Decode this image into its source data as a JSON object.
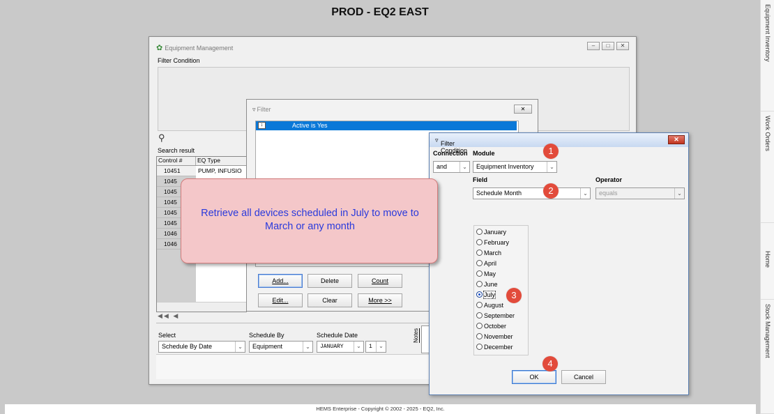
{
  "app": {
    "title": "PROD - EQ2 EAST",
    "footer": "HEMS Enterprise - Copyright © 2002 - 2025 - EQ2, Inc."
  },
  "right_rail": {
    "tabs": [
      "Equipment Inventory",
      "Work Orders",
      "Home",
      "Stock Management"
    ]
  },
  "equipment_window": {
    "title": "Equipment Management",
    "filter_condition_label": "Filter Condition",
    "search_result_label": "Search result",
    "columns": [
      "Control #",
      "EQ Type"
    ],
    "rows": [
      {
        "control": "10451",
        "type": "PUMP, INFUSIO"
      },
      {
        "control": "1045",
        "type": ""
      },
      {
        "control": "1045",
        "type": ""
      },
      {
        "control": "1045",
        "type": ""
      },
      {
        "control": "1045",
        "type": ""
      },
      {
        "control": "1045",
        "type": ""
      },
      {
        "control": "1046",
        "type": ""
      },
      {
        "control": "1046",
        "type": ""
      }
    ],
    "pager": "◀◀ ◀",
    "select_label": "Select",
    "select_value": "Schedule By Date",
    "schedule_by_label": "Schedule By",
    "schedule_by_value": "Equipment",
    "schedule_date_label": "Schedule Date",
    "schedule_month_value": "JANUARY",
    "schedule_day_value": "1",
    "notes_label": "Notes"
  },
  "filter_window": {
    "title": "Filter",
    "selected_condition": "Active is Yes",
    "buttons": {
      "add": "Add...",
      "delete": "Delete",
      "count": "Count",
      "edit": "Edit...",
      "clear": "Clear",
      "more": "More >>"
    }
  },
  "filter_condition_window": {
    "title": "Filter Condition",
    "connection_label": "Connection",
    "connection_value": "and",
    "module_label": "Module",
    "module_value": "Equipment Inventory",
    "field_label": "Field",
    "field_value": "Schedule Month",
    "operator_label": "Operator",
    "operator_value": "equals",
    "months": [
      "January",
      "February",
      "March",
      "April",
      "May",
      "June",
      "July",
      "August",
      "September",
      "October",
      "November",
      "December"
    ],
    "selected_month": "July",
    "ok": "OK",
    "cancel": "Cancel"
  },
  "callout": {
    "text": "Retrieve all devices scheduled in July to move to March or any month"
  },
  "badges": [
    "1",
    "2",
    "3",
    "4"
  ],
  "colors": {
    "selection_blue": "#0a78d8",
    "callout_fill": "#f4c7c9",
    "callout_text": "#2a3adc",
    "badge_red": "#e24b3b"
  }
}
